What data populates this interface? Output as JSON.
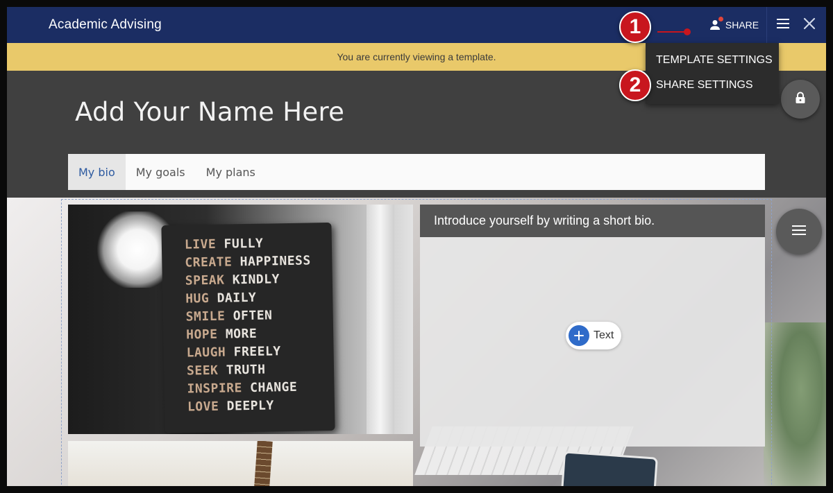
{
  "header": {
    "app_title": "Academic Advising",
    "share_label": "SHARE"
  },
  "banner": {
    "message": "You are currently viewing a template."
  },
  "profile": {
    "name_placeholder": "Add Your Name Here"
  },
  "tabs": [
    {
      "label": "My bio",
      "active": true
    },
    {
      "label": "My goals",
      "active": false
    },
    {
      "label": "My plans",
      "active": false
    }
  ],
  "dropdown": {
    "items": [
      {
        "label": "TEMPLATE SETTINGS"
      },
      {
        "label": "SHARE SETTINGS"
      }
    ]
  },
  "bio": {
    "prompt": "Introduce yourself by writing a short bio.",
    "add_text_label": "Text"
  },
  "photo": {
    "book_lines": [
      {
        "w1": "LIVE",
        "w2": "FULLY"
      },
      {
        "w1": "CREATE",
        "w2": "HAPPINESS"
      },
      {
        "w1": "SPEAK",
        "w2": "KINDLY"
      },
      {
        "w1": "HUG",
        "w2": "DAILY"
      },
      {
        "w1": "SMILE",
        "w2": "OFTEN"
      },
      {
        "w1": "HOPE",
        "w2": "MORE"
      },
      {
        "w1": "LAUGH",
        "w2": "FREELY"
      },
      {
        "w1": "SEEK",
        "w2": "TRUTH"
      },
      {
        "w1": "INSPIRE",
        "w2": "CHANGE"
      },
      {
        "w1": "LOVE",
        "w2": "DEEPLY"
      }
    ]
  },
  "callouts": [
    {
      "number": "1"
    },
    {
      "number": "2"
    }
  ],
  "icons": {
    "share": "user-icon",
    "menu": "hamburger-icon",
    "close": "close-icon",
    "lock": "lock-icon",
    "list": "list-icon",
    "add": "plus-icon"
  },
  "colors": {
    "header_bg": "#1b2d63",
    "banner_bg": "#e9c96a",
    "accent_blue": "#2f6bc9",
    "callout_red": "#c8161e"
  }
}
